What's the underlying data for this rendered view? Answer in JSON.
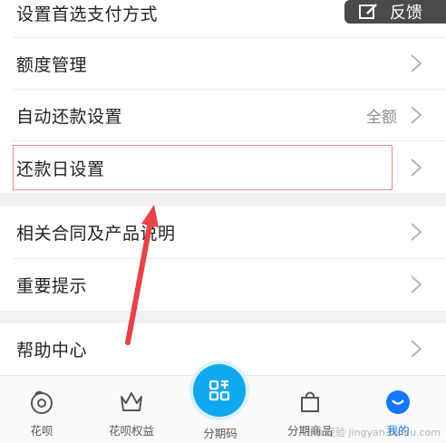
{
  "menu": {
    "items": [
      {
        "label": "设置首选支付方式"
      },
      {
        "label": "额度管理"
      },
      {
        "label": "自动还款设置",
        "value": "全额"
      },
      {
        "label": "还款日设置"
      },
      {
        "label": "相关合同及产品说明"
      },
      {
        "label": "重要提示"
      },
      {
        "label": "帮助中心"
      }
    ]
  },
  "feedback": {
    "label": "反馈"
  },
  "tabbar": {
    "tabs": [
      {
        "label": "花呗"
      },
      {
        "label": "花呗权益"
      },
      {
        "label": "分期码"
      },
      {
        "label": "分期商品"
      },
      {
        "label": "我的"
      }
    ]
  },
  "watermark": {
    "text": "Bai 经验 jingyan.baidu.com"
  },
  "colors": {
    "accent": "#1677ff",
    "center_button": "#10a8ef",
    "annotation": "#e8424a"
  }
}
